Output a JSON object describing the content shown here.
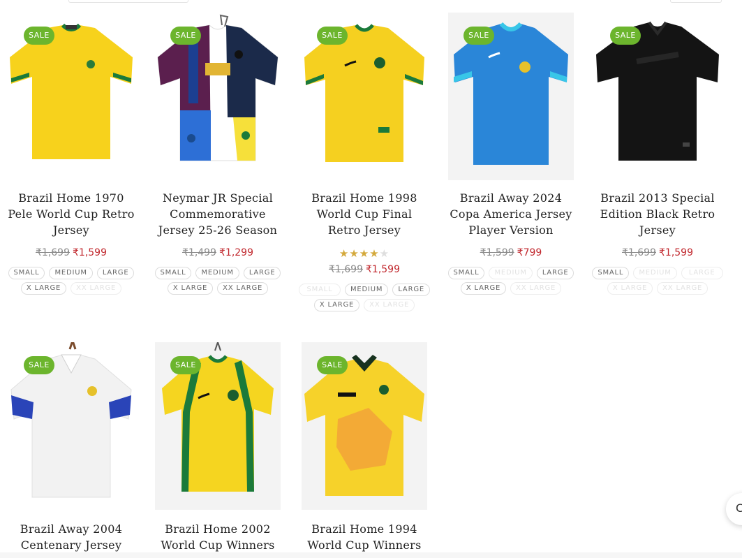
{
  "sale_label": "SALE",
  "colors": {
    "sale_badge": "#6cb52d",
    "sale_price": "#c1272d",
    "old_price": "#8a8a8a",
    "star": "#d4a93c"
  },
  "products": [
    {
      "title_lines": [
        "Brazil Home 1970",
        "Pele World Cup Retro",
        "Jersey"
      ],
      "old_price": "₹1,699",
      "price": "₹1,599",
      "sizes": [
        [
          "SMALL",
          "in"
        ],
        [
          "MEDIUM",
          "in"
        ],
        [
          "LARGE",
          "in"
        ],
        [
          "X LARGE",
          "in"
        ],
        [
          "XX LARGE",
          "out"
        ]
      ]
    },
    {
      "title_lines": [
        "Neymar JR Special",
        "Commemorative",
        "Jersey 25-26 Season"
      ],
      "old_price": "₹1,499",
      "price": "₹1,299",
      "sizes": [
        [
          "SMALL",
          "in"
        ],
        [
          "MEDIUM",
          "in"
        ],
        [
          "LARGE",
          "in"
        ],
        [
          "X LARGE",
          "in"
        ],
        [
          "XX LARGE",
          "in"
        ]
      ]
    },
    {
      "title_lines": [
        "Brazil Home 1998",
        "World Cup Final",
        "Retro Jersey"
      ],
      "rating": 4,
      "old_price": "₹1,699",
      "price": "₹1,599",
      "sizes": [
        [
          "SMALL",
          "out"
        ],
        [
          "MEDIUM",
          "in"
        ],
        [
          "LARGE",
          "in"
        ],
        [
          "X LARGE",
          "in"
        ],
        [
          "XX LARGE",
          "out"
        ]
      ]
    },
    {
      "title_lines": [
        "Brazil Away 2024",
        "Copa America Jersey",
        "Player Version"
      ],
      "old_price": "₹1,599",
      "price": "₹799",
      "sizes": [
        [
          "SMALL",
          "in"
        ],
        [
          "MEDIUM",
          "out"
        ],
        [
          "LARGE",
          "in"
        ],
        [
          "X LARGE",
          "in"
        ],
        [
          "XX LARGE",
          "out"
        ]
      ]
    },
    {
      "title_lines": [
        "Brazil 2013 Special",
        "Edition Black Retro",
        "Jersey"
      ],
      "old_price": "₹1,699",
      "price": "₹1,599",
      "sizes": [
        [
          "SMALL",
          "in"
        ],
        [
          "MEDIUM",
          "out"
        ],
        [
          "LARGE",
          "out"
        ],
        [
          "X LARGE",
          "out"
        ],
        [
          "XX LARGE",
          "out"
        ]
      ]
    },
    {
      "title_lines": [
        "Brazil Away 2004",
        "Centenary Jersey"
      ]
    },
    {
      "title_lines": [
        "Brazil Home 2002",
        "World Cup Winners"
      ]
    },
    {
      "title_lines": [
        "Brazil Home 1994",
        "World Cup Winners"
      ]
    }
  ],
  "chat_icon": "chat-bubble-icon",
  "chat_glyph": "C"
}
